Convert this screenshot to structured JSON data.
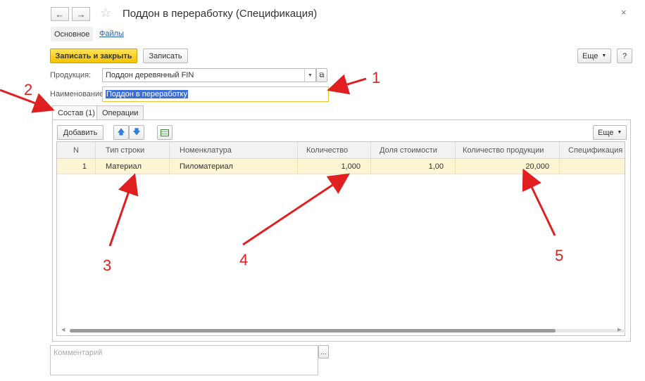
{
  "window": {
    "title": "Поддон в переработку (Спецификация)",
    "back_icon": "←",
    "forward_icon": "→",
    "star_icon": "☆",
    "close_icon": "×"
  },
  "nav_tabs": {
    "main": "Основное",
    "files": "Файлы"
  },
  "toolbar": {
    "save_close": "Записать и закрыть",
    "save": "Записать",
    "more": "Еще",
    "help": "?"
  },
  "form": {
    "product_label": "Продукция:",
    "product_value": "Поддон деревянный FIN",
    "name_label": "Наименование:",
    "name_value": "Поддон в переработку"
  },
  "content_tabs": {
    "composition": "Состав (1)",
    "operations": "Операции"
  },
  "table_toolbar": {
    "add": "Добавить",
    "more": "Еще"
  },
  "table": {
    "columns": [
      "N",
      "Тип строки",
      "Номенклатура",
      "Количество",
      "Доля стоимости",
      "Количество продукции",
      "Спецификация"
    ],
    "rows": [
      {
        "n": "1",
        "type": "Материал",
        "item": "Пиломатериал",
        "qty": "1,000",
        "share": "1,00",
        "product_qty": "20,000",
        "spec": ""
      }
    ]
  },
  "comment_placeholder": "Комментарий",
  "annotations": [
    "1",
    "2",
    "3",
    "4",
    "5"
  ],
  "colors": {
    "accent_yellow": "#f5c400",
    "link_blue": "#2a5fb0",
    "selection_blue": "#3a6fd8",
    "row_highlight": "#fbf5d3",
    "annotation_red": "#e02020"
  }
}
